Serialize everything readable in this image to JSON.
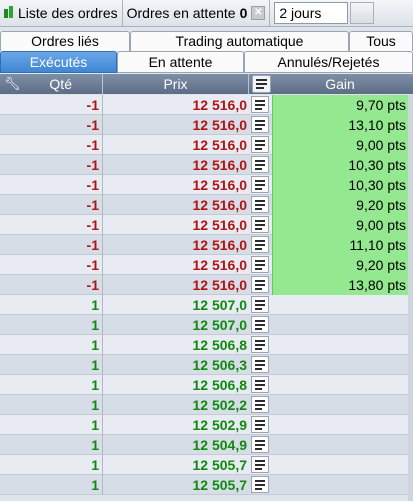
{
  "toolbar": {
    "orders_list_label": "Liste des ordres",
    "pending_label": "Ordres en attente",
    "pending_count": "0",
    "clear_glyph": "✕",
    "period_value": "2 jours"
  },
  "tabs_row1": [
    {
      "label": "Ordres liés"
    },
    {
      "label": "Trading automatique"
    },
    {
      "label": "Tous"
    }
  ],
  "tabs_row2": [
    {
      "label": "Exécutés",
      "active": true
    },
    {
      "label": "En attente",
      "active": false
    },
    {
      "label": "Annulés/Rejetés",
      "active": false
    }
  ],
  "columns": {
    "qte": "Qté",
    "prix": "Prix",
    "gain": "Gain"
  },
  "colors": {
    "sell": "#b11212",
    "buy": "#0f8a0f",
    "gain_bg": "#93e890",
    "active_tab": "#3f86d4"
  },
  "rows": [
    {
      "qte": "-1",
      "prix": "12 516,0",
      "gain": "9,70 pts"
    },
    {
      "qte": "-1",
      "prix": "12 516,0",
      "gain": "13,10 pts"
    },
    {
      "qte": "-1",
      "prix": "12 516,0",
      "gain": "9,00 pts"
    },
    {
      "qte": "-1",
      "prix": "12 516,0",
      "gain": "10,30 pts"
    },
    {
      "qte": "-1",
      "prix": "12 516,0",
      "gain": "10,30 pts"
    },
    {
      "qte": "-1",
      "prix": "12 516,0",
      "gain": "9,20 pts"
    },
    {
      "qte": "-1",
      "prix": "12 516,0",
      "gain": "9,00 pts"
    },
    {
      "qte": "-1",
      "prix": "12 516,0",
      "gain": "11,10 pts"
    },
    {
      "qte": "-1",
      "prix": "12 516,0",
      "gain": "9,20 pts"
    },
    {
      "qte": "-1",
      "prix": "12 516,0",
      "gain": "13,80 pts"
    },
    {
      "qte": "1",
      "prix": "12 507,0",
      "gain": ""
    },
    {
      "qte": "1",
      "prix": "12 507,0",
      "gain": ""
    },
    {
      "qte": "1",
      "prix": "12 506,8",
      "gain": ""
    },
    {
      "qte": "1",
      "prix": "12 506,3",
      "gain": ""
    },
    {
      "qte": "1",
      "prix": "12 506,8",
      "gain": ""
    },
    {
      "qte": "1",
      "prix": "12 502,2",
      "gain": ""
    },
    {
      "qte": "1",
      "prix": "12 502,9",
      "gain": ""
    },
    {
      "qte": "1",
      "prix": "12 504,9",
      "gain": ""
    },
    {
      "qte": "1",
      "prix": "12 505,7",
      "gain": ""
    },
    {
      "qte": "1",
      "prix": "12 505,7",
      "gain": ""
    }
  ]
}
